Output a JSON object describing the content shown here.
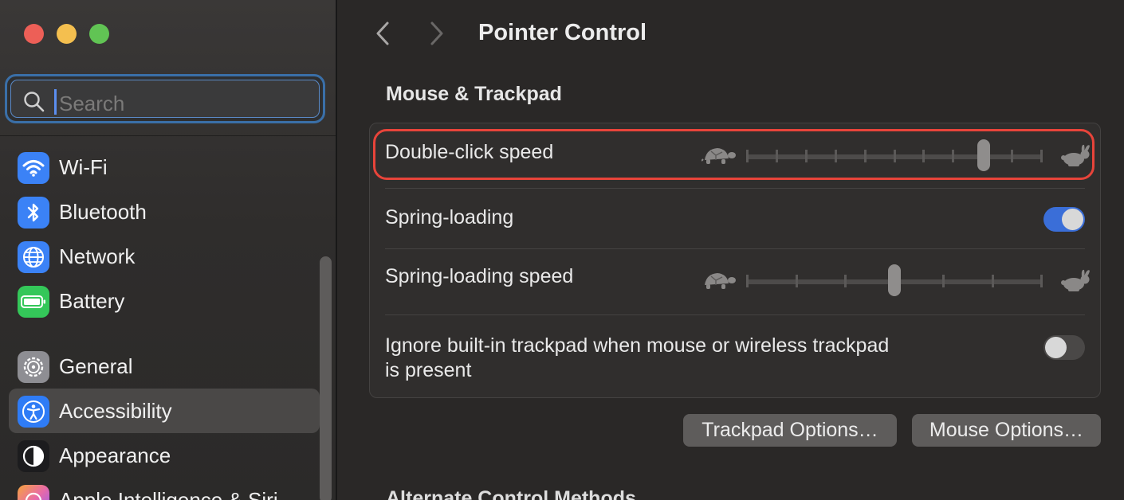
{
  "window": {
    "title": "Pointer Control"
  },
  "sidebar": {
    "search": {
      "placeholder": "Search",
      "value": ""
    },
    "items": [
      {
        "label": "Wi-Fi",
        "icon": "wifi-icon",
        "color": "#3b82f6"
      },
      {
        "label": "Bluetooth",
        "icon": "bluetooth-icon",
        "color": "#3b82f6"
      },
      {
        "label": "Network",
        "icon": "globe-icon",
        "color": "#3b82f6"
      },
      {
        "label": "Battery",
        "icon": "battery-icon",
        "color": "#34c759"
      },
      {
        "label": "General",
        "icon": "gear-icon",
        "color": "#8e8e93"
      },
      {
        "label": "Accessibility",
        "icon": "accessibility-icon",
        "color": "#2f7cf6",
        "selected": true
      },
      {
        "label": "Appearance",
        "icon": "appearance-icon",
        "color": "#1c1c1e"
      },
      {
        "label": "Apple Intelligence & Siri",
        "icon": "siri-icon",
        "color": "#e86aa8"
      }
    ]
  },
  "main": {
    "section_title": "Mouse & Trackpad",
    "rows": {
      "double_click": {
        "label": "Double-click speed",
        "value_fraction": 0.8
      },
      "spring_loading": {
        "label": "Spring-loading",
        "enabled": true
      },
      "spring_speed": {
        "label": "Spring-loading speed",
        "value_fraction": 0.5
      },
      "ignore_trackpad": {
        "label_line1": "Ignore built-in trackpad when mouse or wireless trackpad",
        "label_line2": "is present",
        "enabled": false
      }
    },
    "buttons": {
      "trackpad_options": "Trackpad Options…",
      "mouse_options": "Mouse Options…"
    },
    "next_section_title": "Alternate Control Methods"
  },
  "colors": {
    "accent": "#3a6ed8",
    "highlight": "#e8443a"
  }
}
